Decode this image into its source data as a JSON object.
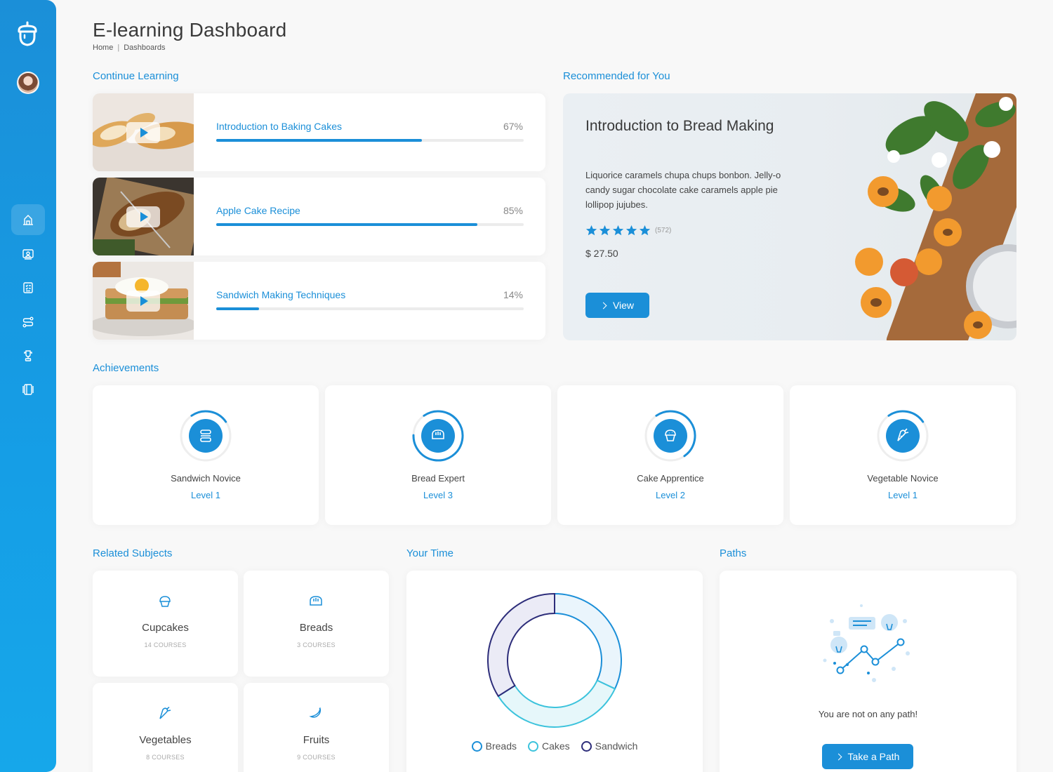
{
  "header": {
    "title": "E-learning Dashboard",
    "breadcrumb": [
      "Home",
      "Dashboards"
    ]
  },
  "sidebar": {
    "items": [
      {
        "icon": "dashboard-icon",
        "active": true
      },
      {
        "icon": "courses-icon",
        "active": false
      },
      {
        "icon": "checklist-icon",
        "active": false
      },
      {
        "icon": "path-icon",
        "active": false
      },
      {
        "icon": "trophy-icon",
        "active": false
      },
      {
        "icon": "book-icon",
        "active": false
      }
    ]
  },
  "continue_learning": {
    "title": "Continue Learning",
    "courses": [
      {
        "name": "Introduction to Baking Cakes",
        "progress_label": "67%",
        "progress": 67
      },
      {
        "name": "Apple Cake Recipe",
        "progress_label": "85%",
        "progress": 85
      },
      {
        "name": "Sandwich Making Techniques",
        "progress_label": "14%",
        "progress": 14
      }
    ]
  },
  "recommended": {
    "title": "Recommended for You",
    "course_title": "Introduction to Bread Making",
    "description": "Liquorice caramels chupa chups bonbon. Jelly-o candy sugar chocolate cake caramels apple pie lollipop jujubes.",
    "rating": 5,
    "rating_count": "(572)",
    "price": "$ 27.50",
    "button": "View"
  },
  "achievements": {
    "title": "Achievements",
    "items": [
      {
        "name": "Sandwich Novice",
        "level": "Level 1",
        "icon": "sandwich-icon",
        "progress": 0.25
      },
      {
        "name": "Bread Expert",
        "level": "Level 3",
        "icon": "bread-icon",
        "progress": 0.85
      },
      {
        "name": "Cake Apprentice",
        "level": "Level 2",
        "icon": "cupcake-icon",
        "progress": 0.5
      },
      {
        "name": "Vegetable Novice",
        "level": "Level 1",
        "icon": "carrot-icon",
        "progress": 0.25
      }
    ]
  },
  "related_subjects": {
    "title": "Related Subjects",
    "items": [
      {
        "name": "Cupcakes",
        "count": "14 COURSES",
        "icon": "cupcake-icon"
      },
      {
        "name": "Breads",
        "count": "3 COURSES",
        "icon": "bread-icon"
      },
      {
        "name": "Vegetables",
        "count": "8 COURSES",
        "icon": "carrot-icon"
      },
      {
        "name": "Fruits",
        "count": "9 COURSES",
        "icon": "banana-icon"
      }
    ]
  },
  "your_time": {
    "title": "Your Time"
  },
  "chart_data": {
    "type": "pie",
    "labels": [
      "Breads",
      "Cakes",
      "Sandwich"
    ],
    "values": [
      32,
      34,
      34
    ],
    "colors": [
      "#1b8fd8",
      "#3cc3dc",
      "#2d2d7a"
    ],
    "fills": [
      "#eaf5fc",
      "#e6f7fa",
      "#ebebf6"
    ]
  },
  "paths": {
    "title": "Paths",
    "message": "You are not on any path!",
    "button": "Take a Path"
  },
  "colors": {
    "accent": "#1b8fd8",
    "sidebar_top": "#1b8fd8",
    "sidebar_bottom": "#16a7ea",
    "background": "#f8f8f8"
  }
}
